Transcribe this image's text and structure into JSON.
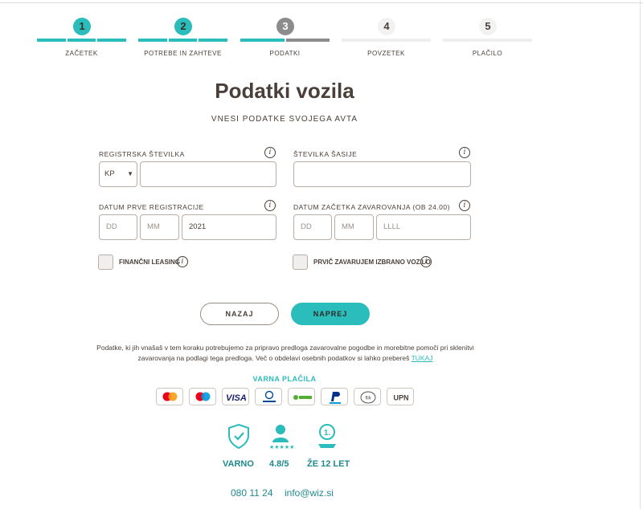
{
  "stepper": [
    {
      "number": "1",
      "label": "ZAČETEK",
      "state": "done"
    },
    {
      "number": "2",
      "label": "POTREBE IN ZAHTEVE",
      "state": "done"
    },
    {
      "number": "3",
      "label": "PODATKI",
      "state": "current"
    },
    {
      "number": "4",
      "label": "POVZETEK",
      "state": "todo"
    },
    {
      "number": "5",
      "label": "PLAČILO",
      "state": "todo"
    }
  ],
  "page": {
    "title": "Podatki vozila",
    "subtitle": "VNESI PODATKE SVOJEGA AVTA"
  },
  "form": {
    "reg_label": "REGISTRSKA ŠTEVILKA",
    "reg_prefix": "KP",
    "reg_value": "",
    "vin_label": "ŠTEVILKA ŠASIJE",
    "vin_value": "",
    "first_reg_label": "DATUM PRVE REGISTRACIJE",
    "first_reg_dd": "DD",
    "first_reg_mm": "MM",
    "first_reg_year": "2021",
    "ins_start_label": "DATUM ZAČETKA ZAVAROVANJA (OB 24.00)",
    "ins_dd": "DD",
    "ins_mm": "MM",
    "ins_year": "LLLL",
    "leasing_label": "FINANČNI LEASING",
    "first_time_label": "PRVIČ ZAVARUJEM IZBRANO VOZILO",
    "info_glyph": "i"
  },
  "buttons": {
    "back": "NAZAJ",
    "next": "NAPREJ"
  },
  "notice": {
    "text": "Podatke, ki jih vnašaš v tem koraku potrebujemo za pripravo predloga zavarovalne pogodbe in morebitne pomoči pri sklenitvi zavarovanja na podlagi tega predloga. Več o obdelavi osebnih podatkov si lahko prebereš",
    "link": "TUKAJ"
  },
  "payments": {
    "label": "VARNA PLAČILA",
    "methods": [
      "mastercard",
      "maestro",
      "VISA",
      "Diners Club",
      "otpbanka",
      "PayPal",
      "flik",
      "UPN"
    ]
  },
  "trust": [
    {
      "label": "VARNO",
      "icon": "shield-hands-icon"
    },
    {
      "label": "4.8/5",
      "icon": "user-stars-icon"
    },
    {
      "label": "ŽE 12 LET",
      "icon": "award-medal-icon",
      "medal_text": "1."
    }
  ],
  "contact": {
    "phone": "080 11 24",
    "email": "info@wiz.si"
  },
  "colors": {
    "teal": "#2bbcbc",
    "dark_teal": "#1f8a8e",
    "text": "#4a4039",
    "grey_step": "#8c8c8c"
  }
}
